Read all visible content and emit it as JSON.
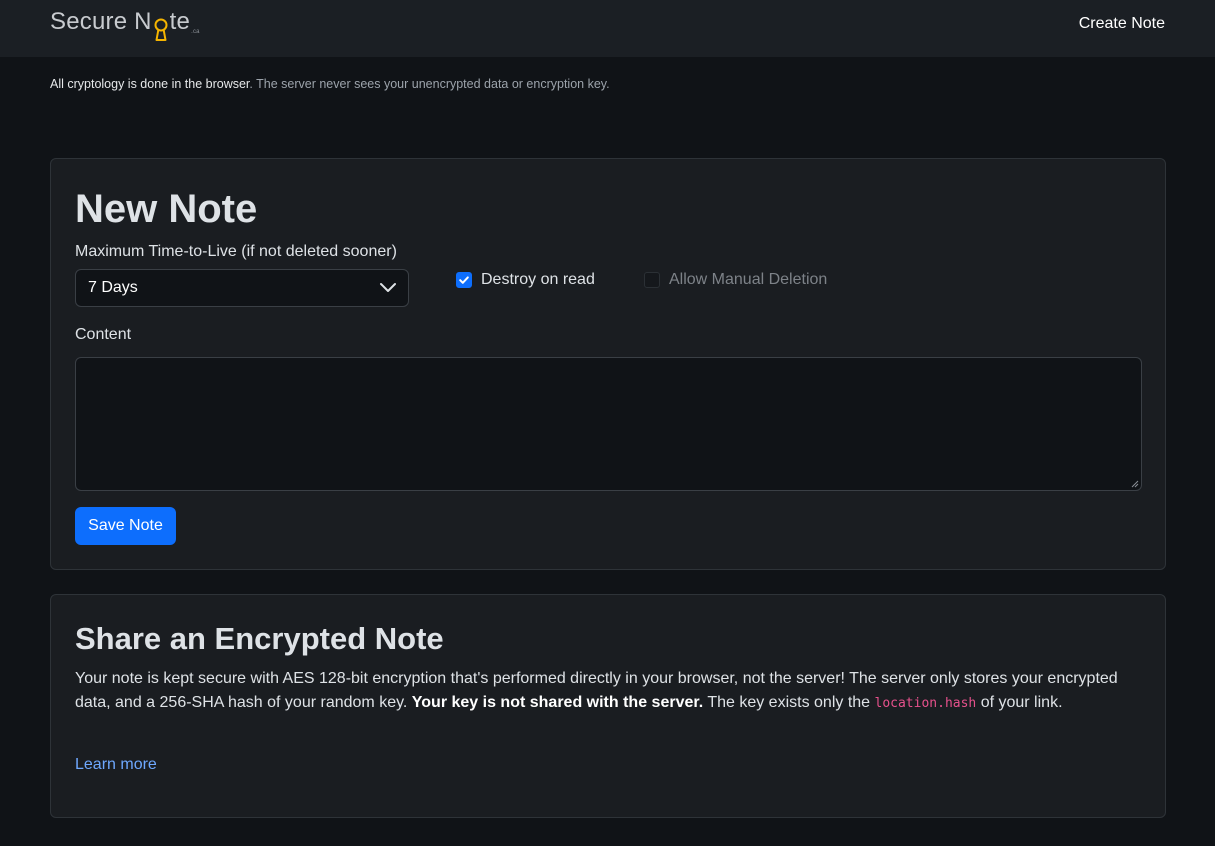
{
  "header": {
    "logo_text_start": "Secure N",
    "logo_text_end": "te",
    "logo_tld": ".ca",
    "nav_link": "Create Note"
  },
  "notice": {
    "strong": "All cryptology is done in the browser",
    "rest": ". The server never sees your unencrypted data or encryption key."
  },
  "new_note": {
    "title": "New Note",
    "ttl_label": "Maximum Time-to-Live (if not deleted sooner)",
    "ttl_value": "7 Days",
    "destroy_on_read_label": "Destroy on read",
    "destroy_on_read_checked": true,
    "manual_deletion_label": "Allow Manual Deletion",
    "manual_deletion_checked": false,
    "content_label": "Content",
    "content_value": "",
    "save_label": "Save Note"
  },
  "share": {
    "title": "Share an Encrypted Note",
    "p1": "Your note is kept secure with AES 128-bit encryption that's performed directly in your browser, not the server! The server only stores your encrypted data, and a 256-SHA hash of your random key. ",
    "p_bold": "Your key is not shared with the server.",
    "p2": " The key exists only the ",
    "p_code": "location.hash",
    "p3": " of your link.",
    "learn_more": "Learn more"
  },
  "colors": {
    "accent": "#0d6efd",
    "link": "#6ea8fe",
    "logo_key": "#f5b400",
    "code": "#e6518c"
  }
}
